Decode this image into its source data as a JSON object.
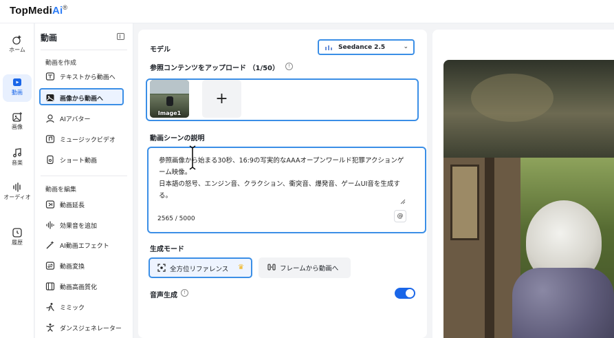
{
  "app": {
    "logo_text": "TopMedi",
    "logo_ai": "Ai",
    "logo_reg": "®"
  },
  "rail": [
    {
      "label": "ホーム",
      "icon": "home-sparkle-icon"
    },
    {
      "label": "動画",
      "icon": "video-icon",
      "active": true
    },
    {
      "label": "画像",
      "icon": "image-icon"
    },
    {
      "label": "音楽",
      "icon": "music-icon"
    },
    {
      "label": "オーディオ",
      "icon": "audio-wave-icon"
    },
    {
      "label": "履歴",
      "icon": "history-icon"
    }
  ],
  "subnav": {
    "title": "動画",
    "create_section": "動画を作成",
    "create_items": [
      {
        "label": "テキストから動画へ",
        "icon": "text-video-icon"
      },
      {
        "label": "画像から動画へ",
        "icon": "image-video-icon",
        "active": true
      },
      {
        "label": "AIアバター",
        "icon": "avatar-icon"
      },
      {
        "label": "ミュージックビデオ",
        "icon": "music-video-icon"
      },
      {
        "label": "ショート動画",
        "icon": "short-video-icon"
      }
    ],
    "edit_section": "動画を編集",
    "edit_items": [
      {
        "label": "動画延長",
        "icon": "extend-icon"
      },
      {
        "label": "効果音を追加",
        "icon": "sound-effect-icon"
      },
      {
        "label": "AI動画エフェクト",
        "icon": "magic-wand-icon"
      },
      {
        "label": "動画変換",
        "icon": "convert-icon"
      },
      {
        "label": "動画高画質化",
        "icon": "enhance-icon"
      },
      {
        "label": "ミミック",
        "icon": "mimic-icon"
      },
      {
        "label": "ダンスジェネレーター",
        "icon": "dance-icon"
      }
    ]
  },
  "form": {
    "model_label": "モデル",
    "model_value": "Seedance 2.5",
    "upload_label": "参照コンテンツをアップロード （1/50）",
    "upload_thumb_label": "Image1",
    "add_symbol": "+",
    "desc_label": "動画シーンの説明",
    "desc_text": "参照画像から始まる30秒、16:9の写実的なAAAオープンワールド犯罪アクションゲーム映像。\n日本語の怒号、エンジン音、クラクション、衝突音、爆発音、ゲームUI音を生成する。",
    "counter": "2565 / 5000",
    "at_symbol": "@",
    "mode_label": "生成モード",
    "mode_options": [
      "全方位リファレンス",
      "フレームから動画へ"
    ],
    "audio_label": "音声生成",
    "audio_enabled": true
  },
  "colors": {
    "accent": "#1a66e8",
    "highlight_border": "#3a8ee6",
    "crown": "#f0b21a"
  }
}
